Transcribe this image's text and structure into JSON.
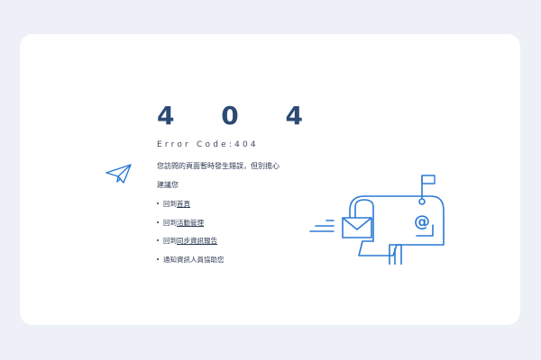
{
  "error": {
    "code_display": "4 0 4",
    "code_line": "Error Code:404",
    "message_line1": "您訪問的頁面暫時發生錯誤，但別擔心",
    "message_line2": "建議您"
  },
  "links": [
    {
      "prefix": "回到",
      "label": "首頁",
      "suffix": ""
    },
    {
      "prefix": "回到",
      "label": "活動管理",
      "suffix": ""
    },
    {
      "prefix": "回到",
      "label": "同步資訊報告",
      "suffix": ""
    },
    {
      "prefix": "通知資訊人員協助您",
      "label": "",
      "suffix": ""
    }
  ],
  "icons": {
    "decor_left": "paper-plane-icon",
    "illustration": "mailbox-illustration",
    "envelope": "envelope-icon",
    "at_sign": "at-sign-icon",
    "flag": "flag-icon"
  },
  "colors": {
    "background": "#edf0f7",
    "card": "#ffffff",
    "heading": "#2b4a74",
    "text": "#2c3a52",
    "accent": "#2a7ad4"
  }
}
